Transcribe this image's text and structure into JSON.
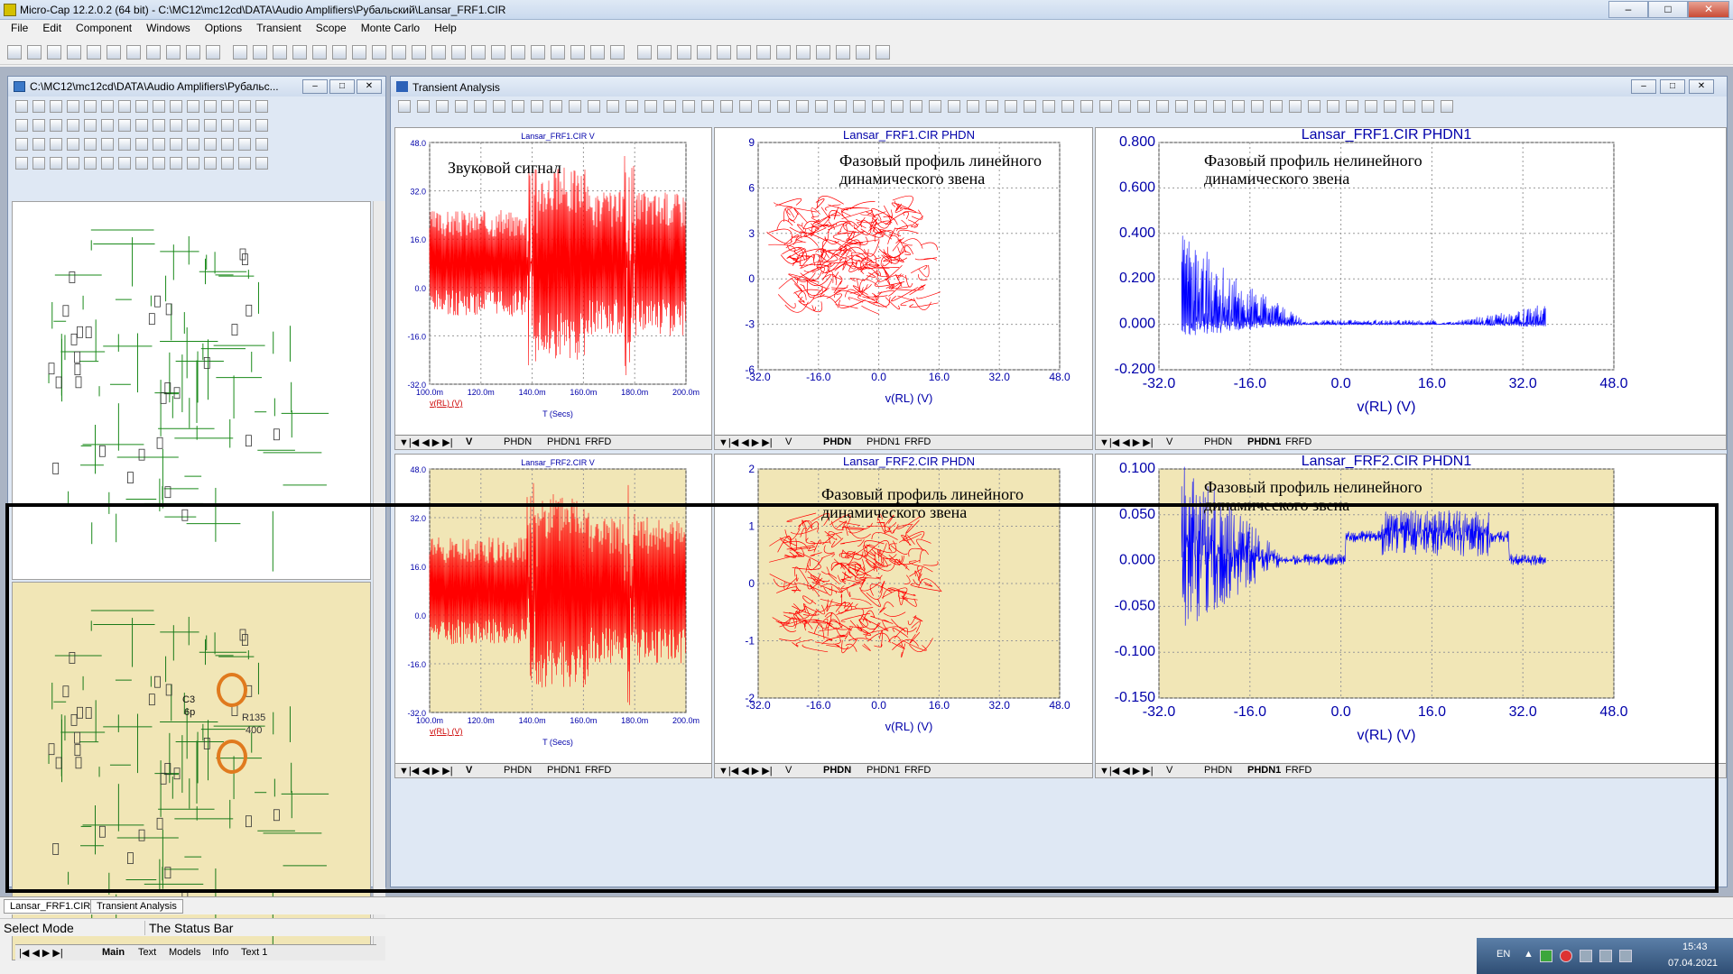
{
  "window": {
    "title": "Micro-Cap 12.2.0.2 (64 bit) - C:\\MC12\\mc12cd\\DATA\\Audio Amplifiers\\Рубальский\\Lansar_FRF1.CIR",
    "min": "–",
    "max": "□",
    "close": "✕"
  },
  "menu": [
    "File",
    "Edit",
    "Component",
    "Windows",
    "Options",
    "Transient",
    "Scope",
    "Monte Carlo",
    "Help"
  ],
  "schematic": {
    "title": "C:\\MC12\\mc12cd\\DATA\\Audio Amplifiers\\Рубальс...",
    "tabs": [
      "Main",
      "Text",
      "Models",
      "Info",
      "Text 1"
    ],
    "labels": {
      "c3": "C3",
      "c3v": "6p",
      "r135": "R135",
      "r135v": "400"
    }
  },
  "transient": {
    "title": "Transient Analysis"
  },
  "plots": [
    {
      "title": "Lansar_FRF1.CIR V",
      "annotation": "Звуковой сигнал",
      "yticks": [
        "48.0",
        "32.0",
        "16.0",
        "0.0",
        "-16.0",
        "-32.0"
      ],
      "xticks": [
        "100.0m",
        "120.0m",
        "140.0m",
        "160.0m",
        "180.0m",
        "200.0m"
      ],
      "xvar": "v(RL) (V)",
      "xlabel": "T (Secs)",
      "tabs": [
        "V",
        "PHDN",
        "PHDN1",
        "FRFD"
      ],
      "active": "V"
    },
    {
      "title": "Lansar_FRF1.CIR PHDN",
      "annotation": "Фазовый профиль линейного динамического звена",
      "yticks": [
        "9",
        "6",
        "3",
        "0",
        "-3",
        "-6"
      ],
      "xticks": [
        "-32.0",
        "-16.0",
        "0.0",
        "16.0",
        "32.0",
        "48.0"
      ],
      "xlabel": "v(RL) (V)",
      "tabs": [
        "V",
        "PHDN",
        "PHDN1",
        "FRFD"
      ],
      "active": "PHDN"
    },
    {
      "title": "Lansar_FRF1.CIR PHDN1",
      "annotation": "Фазовый профиль нелинейного динамического звена",
      "yticks": [
        "0.800",
        "0.600",
        "0.400",
        "0.200",
        "0.000",
        "-0.200"
      ],
      "xticks": [
        "-32.0",
        "-16.0",
        "0.0",
        "16.0",
        "32.0",
        "48.0"
      ],
      "xlabel": "v(RL) (V)",
      "tabs": [
        "V",
        "PHDN",
        "PHDN1",
        "FRFD"
      ],
      "active": "PHDN1"
    },
    {
      "title": "Lansar_FRF2.CIR V",
      "annotation": "",
      "yticks": [
        "48.0",
        "32.0",
        "16.0",
        "0.0",
        "-16.0",
        "-32.0"
      ],
      "xticks": [
        "100.0m",
        "120.0m",
        "140.0m",
        "160.0m",
        "180.0m",
        "200.0m"
      ],
      "xvar": "v(RL) (V)",
      "xlabel": "T (Secs)",
      "tabs": [
        "V",
        "PHDN",
        "PHDN1",
        "FRFD"
      ],
      "active": "V"
    },
    {
      "title": "Lansar_FRF2.CIR PHDN",
      "annotation": "Фазовый профиль линейного динамического звена",
      "yticks": [
        "2",
        "1",
        "0",
        "-1",
        "-2"
      ],
      "xticks": [
        "-32.0",
        "-16.0",
        "0.0",
        "16.0",
        "32.0",
        "48.0"
      ],
      "xlabel": "v(RL) (V)",
      "tabs": [
        "V",
        "PHDN",
        "PHDN1",
        "FRFD"
      ],
      "active": "PHDN"
    },
    {
      "title": "Lansar_FRF2.CIR PHDN1",
      "annotation": "Фазовый профиль нелинейного динамического звена",
      "yticks": [
        "0.100",
        "0.050",
        "0.000",
        "-0.050",
        "-0.100",
        "-0.150"
      ],
      "xticks": [
        "-32.0",
        "-16.0",
        "0.0",
        "16.0",
        "32.0",
        "48.0"
      ],
      "xlabel": "v(RL) (V)",
      "tabs": [
        "V",
        "PHDN",
        "PHDN1",
        "FRFD"
      ],
      "active": "PHDN1"
    }
  ],
  "bottom_tabs": [
    "Lansar_FRF1.CIR",
    "Transient Analysis"
  ],
  "status": {
    "mode": "Select Mode",
    "bar": "The Status Bar"
  },
  "taskbar": {
    "lang": "EN",
    "time": "15:43",
    "date": "07.04.2021"
  },
  "colors": {
    "signal": "#ff0000",
    "phase": "#0000ff",
    "axis": "#0000aa",
    "plotbg_alt": "#f1e6b6"
  }
}
